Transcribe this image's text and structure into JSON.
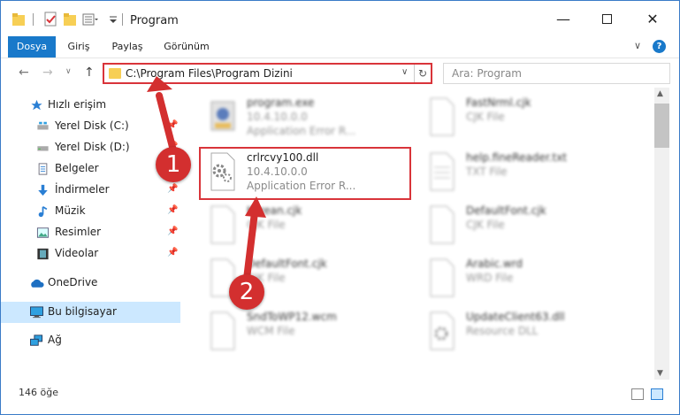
{
  "window": {
    "title": "Program"
  },
  "ribbon": {
    "tabs": [
      "Dosya",
      "Giriş",
      "Paylaş",
      "Görünüm"
    ]
  },
  "address": {
    "path": "C:\\Program Files\\Program Dizini"
  },
  "search": {
    "placeholder": "Ara: Program"
  },
  "sidebar": {
    "items": [
      {
        "label": "Hızlı erişim",
        "icon": "star-icon"
      },
      {
        "label": "Yerel Disk (C:)",
        "icon": "drive-icon",
        "pinned": true
      },
      {
        "label": "Yerel Disk (D:)",
        "icon": "drive-icon",
        "pinned": true
      },
      {
        "label": "Belgeler",
        "icon": "documents-icon",
        "pinned": true
      },
      {
        "label": "İndirmeler",
        "icon": "download-icon",
        "pinned": true
      },
      {
        "label": "Müzik",
        "icon": "music-icon",
        "pinned": true
      },
      {
        "label": "Resimler",
        "icon": "pictures-icon",
        "pinned": true
      },
      {
        "label": "Videolar",
        "icon": "videos-icon",
        "pinned": true
      },
      {
        "label": "OneDrive",
        "icon": "cloud-icon"
      },
      {
        "label": "Bu bilgisayar",
        "icon": "computer-icon",
        "selected": true
      },
      {
        "label": "Ağ",
        "icon": "network-icon"
      }
    ]
  },
  "files": [
    {
      "name": "program.exe",
      "line2": "10.4.10.0.0",
      "line3": "Application Error R..."
    },
    {
      "name": "FastNrml.cjk",
      "line2": "CJK File"
    },
    {
      "name": "crlrcvy100.dll",
      "line2": "10.4.10.0.0",
      "line3": "Application Error R..."
    },
    {
      "name": "help.fineReader.txt",
      "line2": "TXT File"
    },
    {
      "name": "Korean.cjk",
      "line2": "CJK File"
    },
    {
      "name": "DefaultFont.cjk",
      "line2": "CJK File"
    },
    {
      "name": "DefaultFont.cjk",
      "line2": "CJK File"
    },
    {
      "name": "Arabic.wrd",
      "line2": "WRD File"
    },
    {
      "name": "SndToWP12.wcm",
      "line2": "WCM File"
    },
    {
      "name": "UpdateClient63.dll",
      "line2": "Resource DLL"
    }
  ],
  "status": {
    "count": "146 öğe"
  },
  "annotations": {
    "step1": "1",
    "step2": "2"
  },
  "colors": {
    "accent": "#1979ca",
    "highlight": "#d9343a",
    "badge": "#d32f2f"
  }
}
